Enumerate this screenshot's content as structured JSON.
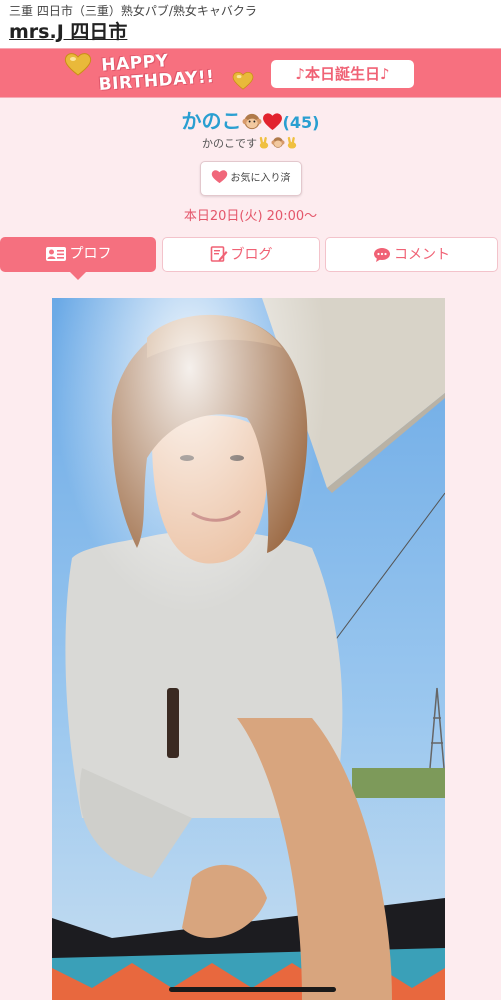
{
  "header": {
    "breadcrumb": "三重 四日市（三重）熟女パブ/熟女キャバクラ",
    "shop_name": "mrs.J 四日市"
  },
  "banner": {
    "line1": "HAPPY",
    "line2": "BIRTHDAY!!",
    "today_label": "♪本日誕生日♪"
  },
  "profile": {
    "name": "かのこ",
    "age": "(45)",
    "tagline": "かのこです",
    "favorite_label": "お気に入り済",
    "schedule": "本日20日(火) 20:00〜"
  },
  "tabs": [
    {
      "label": "プロフ",
      "active": true
    },
    {
      "label": "ブログ",
      "active": false
    },
    {
      "label": "コメント",
      "active": false
    }
  ],
  "colors": {
    "accent_pink": "#f5707f",
    "name_blue": "#2a9fd1",
    "background": "#fdecef"
  }
}
